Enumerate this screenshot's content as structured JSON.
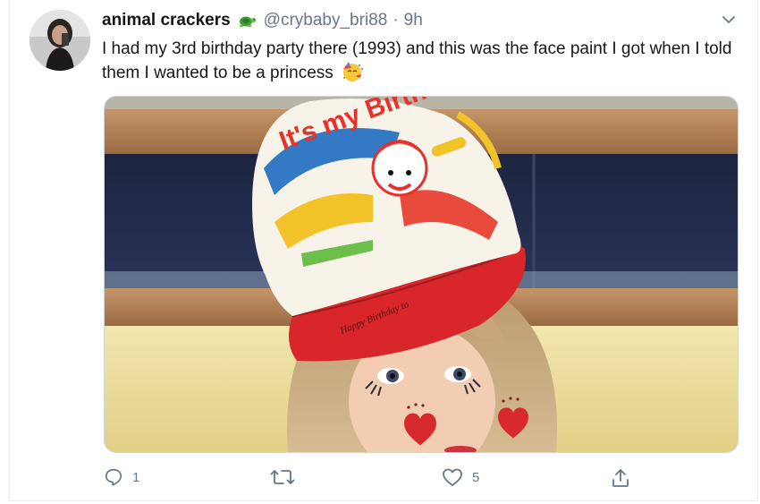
{
  "tweet": {
    "display_name": "animal crackers",
    "name_emoji": "turtle-icon",
    "handle": "@crybaby_bri88",
    "separator": "·",
    "time": "9h",
    "text": "I had my 3rd birthday party there (1993) and this was the face paint I got when I told them I wanted to be a princess",
    "text_emoji": "partying-face-icon"
  },
  "hat": {
    "brand_text": "It's my Birthday",
    "brim_text": "Happy Birthday to"
  },
  "actions": {
    "reply_count": "1",
    "retweet_count": "",
    "like_count": "5"
  },
  "colors": {
    "text_primary": "#14171a",
    "text_secondary": "#657786",
    "border": "#e6ecf0",
    "hat_red": "#d8262b",
    "wall_yellow": "#efe1a3"
  }
}
